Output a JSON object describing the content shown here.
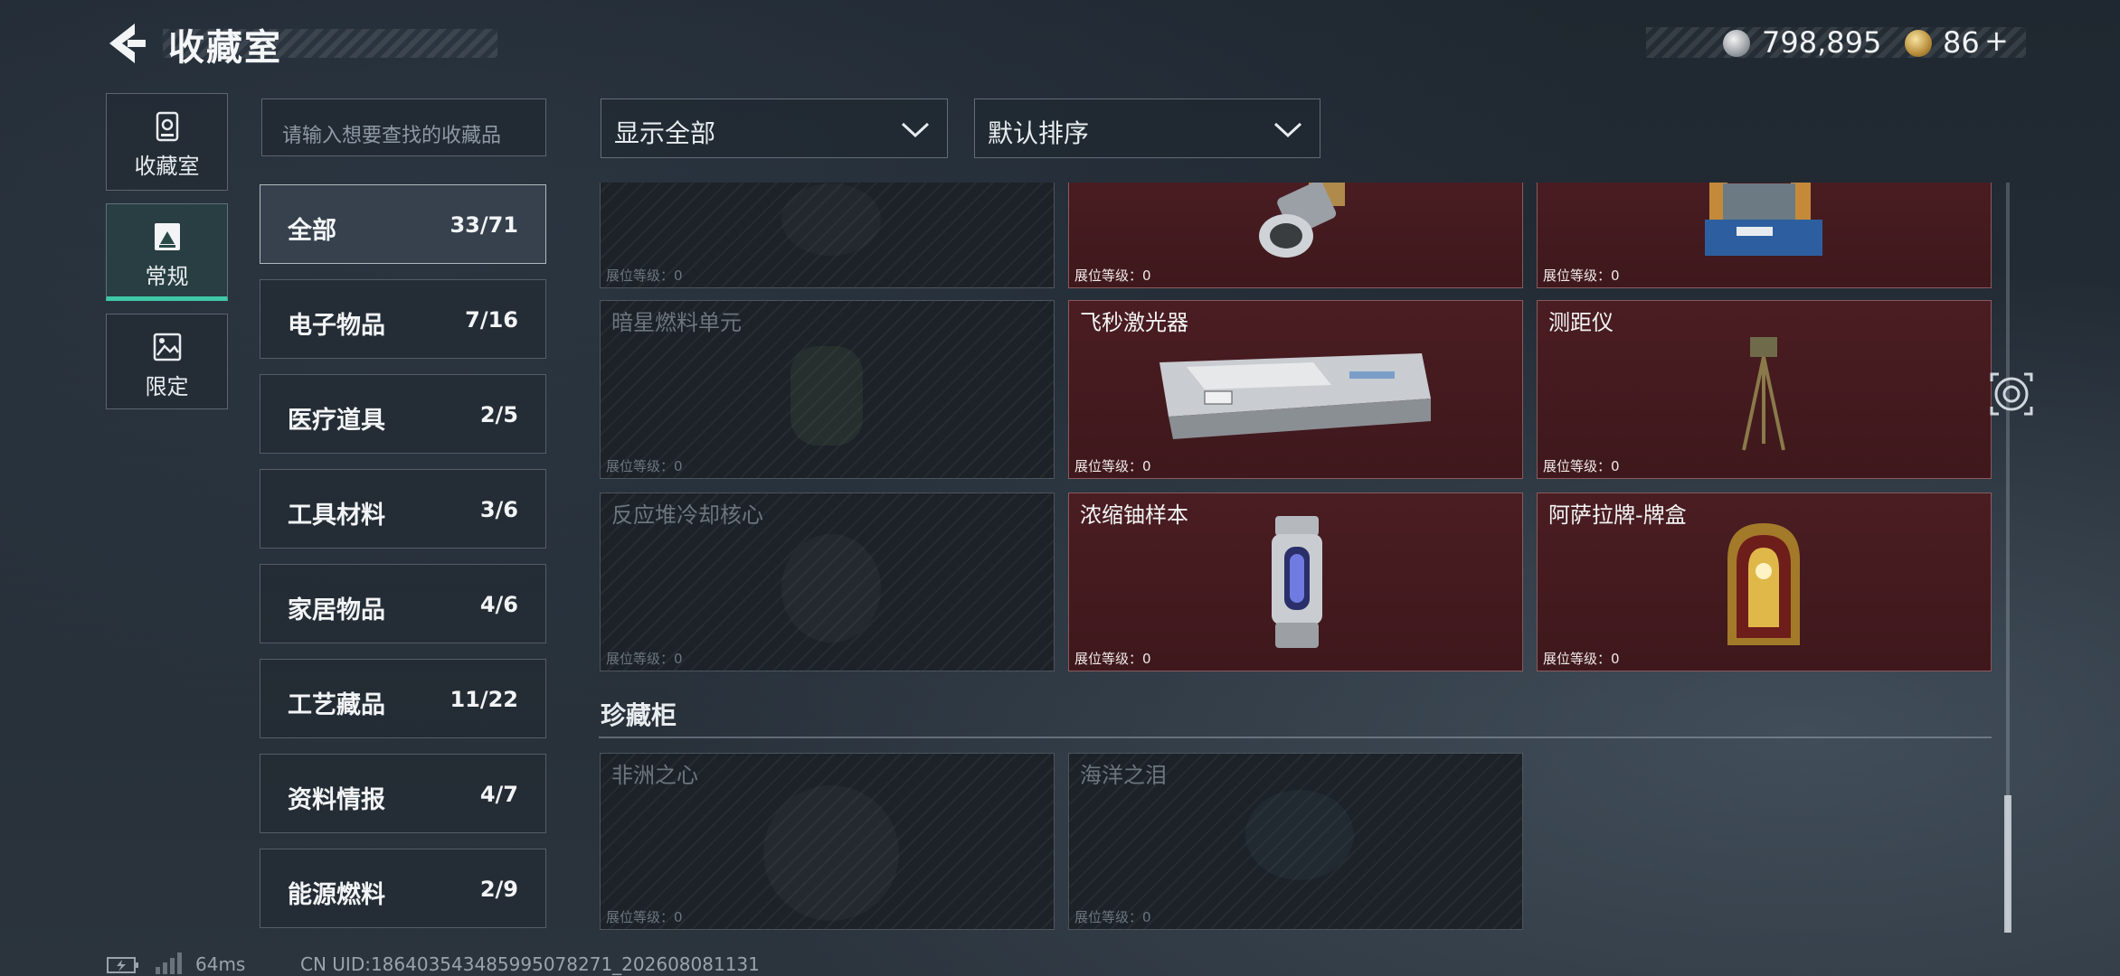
{
  "header": {
    "title": "收藏室"
  },
  "currency": {
    "silver": "798,895",
    "gold": "86",
    "gold_plus": "+"
  },
  "rail": [
    {
      "label": "收藏室",
      "icon": "vault-icon"
    },
    {
      "label": "常规",
      "icon": "display-icon",
      "active": true
    },
    {
      "label": "限定",
      "icon": "picture-icon"
    }
  ],
  "search": {
    "placeholder": "请输入想要查找的收藏品"
  },
  "categories": [
    {
      "name": "全部",
      "count": "33/71",
      "active": true
    },
    {
      "name": "电子物品",
      "count": "7/16"
    },
    {
      "name": "医疗道具",
      "count": "2/5"
    },
    {
      "name": "工具材料",
      "count": "3/6"
    },
    {
      "name": "家居物品",
      "count": "4/6"
    },
    {
      "name": "工艺藏品",
      "count": "11/22"
    },
    {
      "name": "资料情报",
      "count": "4/7"
    },
    {
      "name": "能源燃料",
      "count": "2/9"
    }
  ],
  "filters": {
    "show": "显示全部",
    "sort": "默认排序"
  },
  "level_label": "展位等级：0",
  "items": [
    {
      "name": "",
      "owned": false
    },
    {
      "name": "",
      "owned": true
    },
    {
      "name": "",
      "owned": true
    },
    {
      "name": "暗星燃料单元",
      "owned": false
    },
    {
      "name": "飞秒激光器",
      "owned": true
    },
    {
      "name": "测距仪",
      "owned": true
    },
    {
      "name": "反应堆冷却核心",
      "owned": false
    },
    {
      "name": "浓缩铀样本",
      "owned": true
    },
    {
      "name": "阿萨拉牌-牌盒",
      "owned": true
    }
  ],
  "section": {
    "title": "珍藏柜"
  },
  "treasures": [
    {
      "name": "非洲之心",
      "owned": false
    },
    {
      "name": "海洋之泪",
      "owned": false
    }
  ],
  "footer": {
    "ping": "64ms",
    "uid": "CN UID:186403543485995078271_202608081131"
  },
  "colors": {
    "accent": "#3fc9a6",
    "owned_card": "#4a1d22",
    "locked_card": "#1c2228"
  }
}
